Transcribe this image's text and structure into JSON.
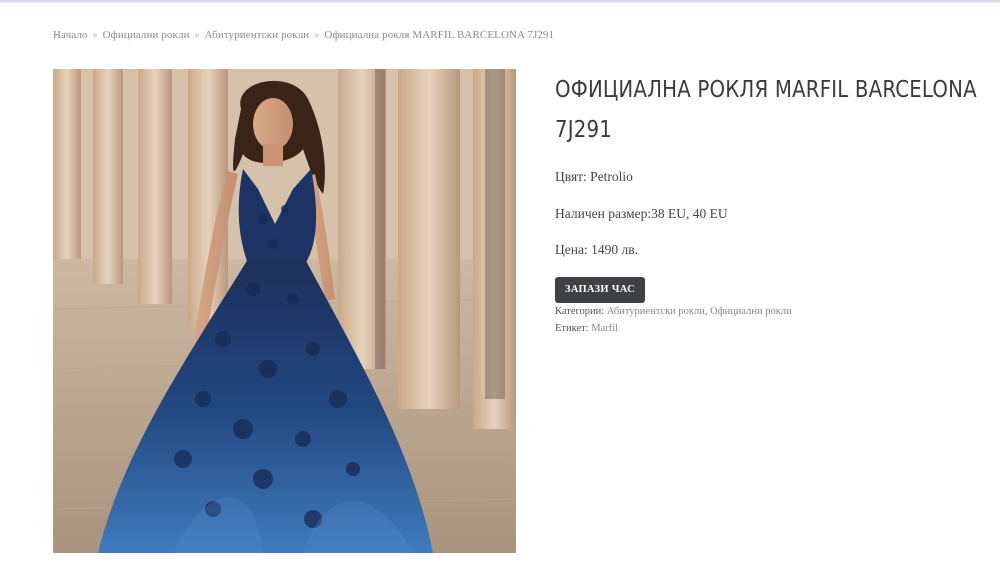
{
  "breadcrumb": {
    "items": [
      "Начало",
      "Официални рокли",
      "Абитуриентски рокли"
    ],
    "separator": "»",
    "current": "Официална рокля MARFIL BARCELONA 7J291"
  },
  "product": {
    "image_alt": "Синя официална рокля",
    "title": "ОФИЦИАЛНА РОКЛЯ MARFIL BARCELONA 7J291",
    "color_line": "Цвят: Petrolio",
    "size_line": "Наличен размер:38 EU, 40 EU",
    "price_line": "Цена: 1490 лв.",
    "book_button": "ЗАПАЗИ ЧАС",
    "categories_label": "Категории:",
    "categories": [
      "Абитуриентски рокли",
      "Официални рокли"
    ],
    "category_separator": ",",
    "tag_label": "Етикет:",
    "tag": "Marfil"
  },
  "colors": {
    "button_bg": "#3f4144",
    "title_text": "#3b3b3b",
    "dress_blue": "#1f3f7a"
  }
}
